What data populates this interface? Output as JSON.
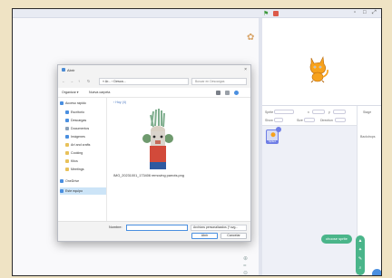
{
  "dialog": {
    "title": "Abrir",
    "close_symbol": "×",
    "nav_buttons": [
      "←",
      "→",
      "↑",
      "↻"
    ],
    "path": "» Ar... › Desca...",
    "search_placeholder": "Buscar en Descargas",
    "organize": "Organizar ▾",
    "new_folder": "Nueva carpeta",
    "folder_crumb": "› Hoy (4)",
    "nav_items": [
      {
        "label": "Acceso rápido",
        "icon": "star-icon",
        "color": "#4a8fe0",
        "selected": false
      },
      {
        "label": "Escritorio",
        "icon": "desktop-icon",
        "color": "#4a8fe0",
        "selected": false
      },
      {
        "label": "Descargas",
        "icon": "download-icon",
        "color": "#4a8fe0",
        "selected": false
      },
      {
        "label": "Documentos",
        "icon": "documents-icon",
        "color": "#8aa0b8",
        "selected": false
      },
      {
        "label": "Imágenes",
        "icon": "pictures-icon",
        "color": "#4a8fe0",
        "selected": false
      },
      {
        "label": "Art and crafts",
        "icon": "folder-icon",
        "color": "#e8c15a",
        "selected": false
      },
      {
        "label": "Cooking",
        "icon": "folder-icon",
        "color": "#e8c15a",
        "selected": false
      },
      {
        "label": "Kitcs",
        "icon": "folder-icon",
        "color": "#e8c15a",
        "selected": false
      },
      {
        "label": "Meetings",
        "icon": "folder-icon",
        "color": "#e8c15a",
        "selected": false
      },
      {
        "label": "OneDrive",
        "icon": "cloud-icon",
        "color": "#4a8fe0",
        "selected": false
      },
      {
        "label": "Este equipo",
        "icon": "computer-icon",
        "color": "#4a8fe0",
        "selected": true
      }
    ],
    "file": {
      "name": "IMG_20231001_173406 removing parrots.png"
    },
    "filename_label": "Nombre:",
    "filename_value": "",
    "filetype": "Archivos personalizados (*.svg...",
    "open_button": "Abrir",
    "cancel_button": "Cancelar"
  },
  "scratch": {
    "sprite_labels": [
      "Sprite",
      "x",
      "y",
      "Show",
      "Size",
      "Direction"
    ],
    "sprite_name": "Sprite1",
    "stage_label": "Stage",
    "backdrops_label": "Backdrops",
    "pill_label": "choose sprite",
    "accent": "#4ab58a"
  }
}
